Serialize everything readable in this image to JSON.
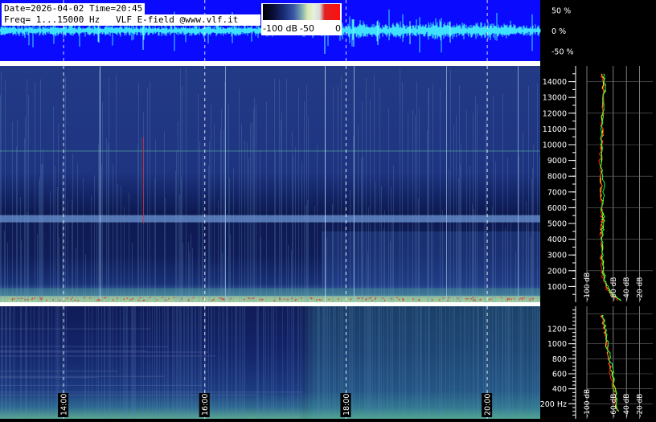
{
  "header": {
    "line1": "Date=2026-04-02 Time=20:45",
    "line2": "Freq= 1...15000 Hz   VLF E-field @www.vlf.it"
  },
  "colorbar": {
    "labels": [
      "-100 dB",
      "-50",
      "0"
    ],
    "colors": [
      "#000000",
      "#1a2e7a",
      "#3a58a8",
      "#7aa8b0",
      "#e8f0e0",
      "#e02020"
    ]
  },
  "chart_data": [
    {
      "type": "line",
      "name": "waveform",
      "ylim": [
        -75,
        75
      ],
      "y_tick_labels": [
        "50 %",
        "0 %",
        "-50 %"
      ],
      "y_tick_values": [
        50,
        0,
        -50
      ],
      "x_tick_labels": [
        "14:00",
        "16:00",
        "18:00",
        "20:00"
      ],
      "x_tick_values": [
        14,
        16,
        18,
        20
      ],
      "xlim": [
        13.1,
        20.75
      ],
      "colors": {
        "background": "#0a0aff",
        "trace": "#40e0ff"
      }
    },
    {
      "type": "heatmap",
      "name": "spectrogram-full",
      "ylim": [
        0,
        15000
      ],
      "y_tick_labels": [
        "1000",
        "2000",
        "3000",
        "4000",
        "5000",
        "6000",
        "7000",
        "8000",
        "9000",
        "10000",
        "11000",
        "12000",
        "13000",
        "14000"
      ],
      "y_tick_values": [
        1000,
        2000,
        3000,
        4000,
        5000,
        6000,
        7000,
        8000,
        9000,
        10000,
        11000,
        12000,
        13000,
        14000
      ],
      "x_tick_values": [
        14,
        16,
        18,
        20
      ],
      "xlim": [
        13.1,
        20.75
      ],
      "features": [
        {
          "kind": "band",
          "freq": 5300,
          "note": "bright horizontal band"
        },
        {
          "kind": "band",
          "freq": 9600,
          "note": "faint horizontal line"
        },
        {
          "kind": "floor",
          "freq": 200,
          "note": "strong low-frequency emission"
        }
      ]
    },
    {
      "type": "line",
      "name": "spectrum-full",
      "xlim": [
        -100,
        0
      ],
      "x_tick_labels": [
        "-100 dB",
        "-60 dB",
        "-40 dB",
        "-20 dB"
      ],
      "x_tick_values": [
        -100,
        -60,
        -40,
        -20
      ],
      "ylim": [
        0,
        15000
      ],
      "series": [
        {
          "name": "",
          "color": "#ffff00",
          "x": [
            -76,
            -74,
            -75,
            -76,
            -77,
            -78,
            -79,
            -78,
            -78,
            -77,
            -76,
            -76,
            -77,
            -78,
            -77,
            -76,
            -74,
            -70,
            -62,
            -50
          ],
          "y": [
            14500,
            14000,
            13000,
            12000,
            11000,
            10000,
            9000,
            8000,
            7000,
            6000,
            5300,
            5000,
            4500,
            4000,
            3000,
            2000,
            1500,
            1000,
            500,
            100
          ]
        },
        {
          "name": "",
          "color": "#ff2020",
          "x": [
            -77,
            -75,
            -76,
            -76,
            -76,
            -78,
            -80,
            -79,
            -79,
            -78,
            -77,
            -77,
            -78,
            -79,
            -78,
            -77,
            -75,
            -72,
            -64,
            -52
          ],
          "y": [
            14500,
            14000,
            13000,
            12000,
            11000,
            10000,
            9000,
            8000,
            7000,
            6000,
            5300,
            5000,
            4500,
            4000,
            3000,
            2000,
            1500,
            1000,
            500,
            100
          ]
        },
        {
          "name": "",
          "color": "#20ff40",
          "x": [
            -75,
            -73,
            -74,
            -75,
            -78,
            -77,
            -78,
            -76,
            -75,
            -76,
            -75,
            -75,
            -76,
            -77,
            -76,
            -75,
            -73,
            -69,
            -61,
            -49
          ],
          "y": [
            14500,
            14000,
            13000,
            12000,
            11000,
            10000,
            9000,
            8000,
            7000,
            6000,
            5300,
            5000,
            4500,
            4000,
            3000,
            2000,
            1500,
            1000,
            500,
            100
          ]
        }
      ]
    },
    {
      "type": "heatmap",
      "name": "spectrogram-low",
      "ylim": [
        0,
        1500
      ],
      "y_tick_labels": [
        "200 Hz",
        "400",
        "600",
        "800",
        "1000",
        "1200"
      ],
      "y_tick_values": [
        200,
        400,
        600,
        800,
        1000,
        1200
      ],
      "x_tick_labels": [
        "14:00",
        "16:00",
        "18:00",
        "20:00"
      ],
      "x_tick_values": [
        14,
        16,
        18,
        20
      ],
      "xlim": [
        13.1,
        20.75
      ]
    },
    {
      "type": "line",
      "name": "spectrum-low",
      "xlim": [
        -100,
        0
      ],
      "x_tick_labels": [
        "-100 dB",
        "-60 dB",
        "-40 dB",
        "-20 dB"
      ],
      "x_tick_values": [
        -100,
        -60,
        -40,
        -20
      ],
      "ylim": [
        0,
        1500
      ],
      "series": [
        {
          "name": "",
          "color": "#ffff00",
          "x": [
            -77,
            -75,
            -72,
            -70,
            -67,
            -64,
            -60,
            -57,
            -53
          ],
          "y": [
            1380,
            1300,
            1150,
            1000,
            850,
            700,
            500,
            300,
            100
          ]
        },
        {
          "name": "",
          "color": "#ff2020",
          "x": [
            -78,
            -76,
            -73,
            -71,
            -68,
            -65,
            -62,
            -58,
            -55
          ],
          "y": [
            1380,
            1300,
            1150,
            1000,
            850,
            700,
            500,
            300,
            100
          ]
        },
        {
          "name": "",
          "color": "#20ff40",
          "x": [
            -76,
            -74,
            -71,
            -68,
            -66,
            -63,
            -59,
            -56,
            -52
          ],
          "y": [
            1380,
            1300,
            1150,
            1000,
            850,
            700,
            500,
            300,
            100
          ]
        }
      ]
    }
  ]
}
